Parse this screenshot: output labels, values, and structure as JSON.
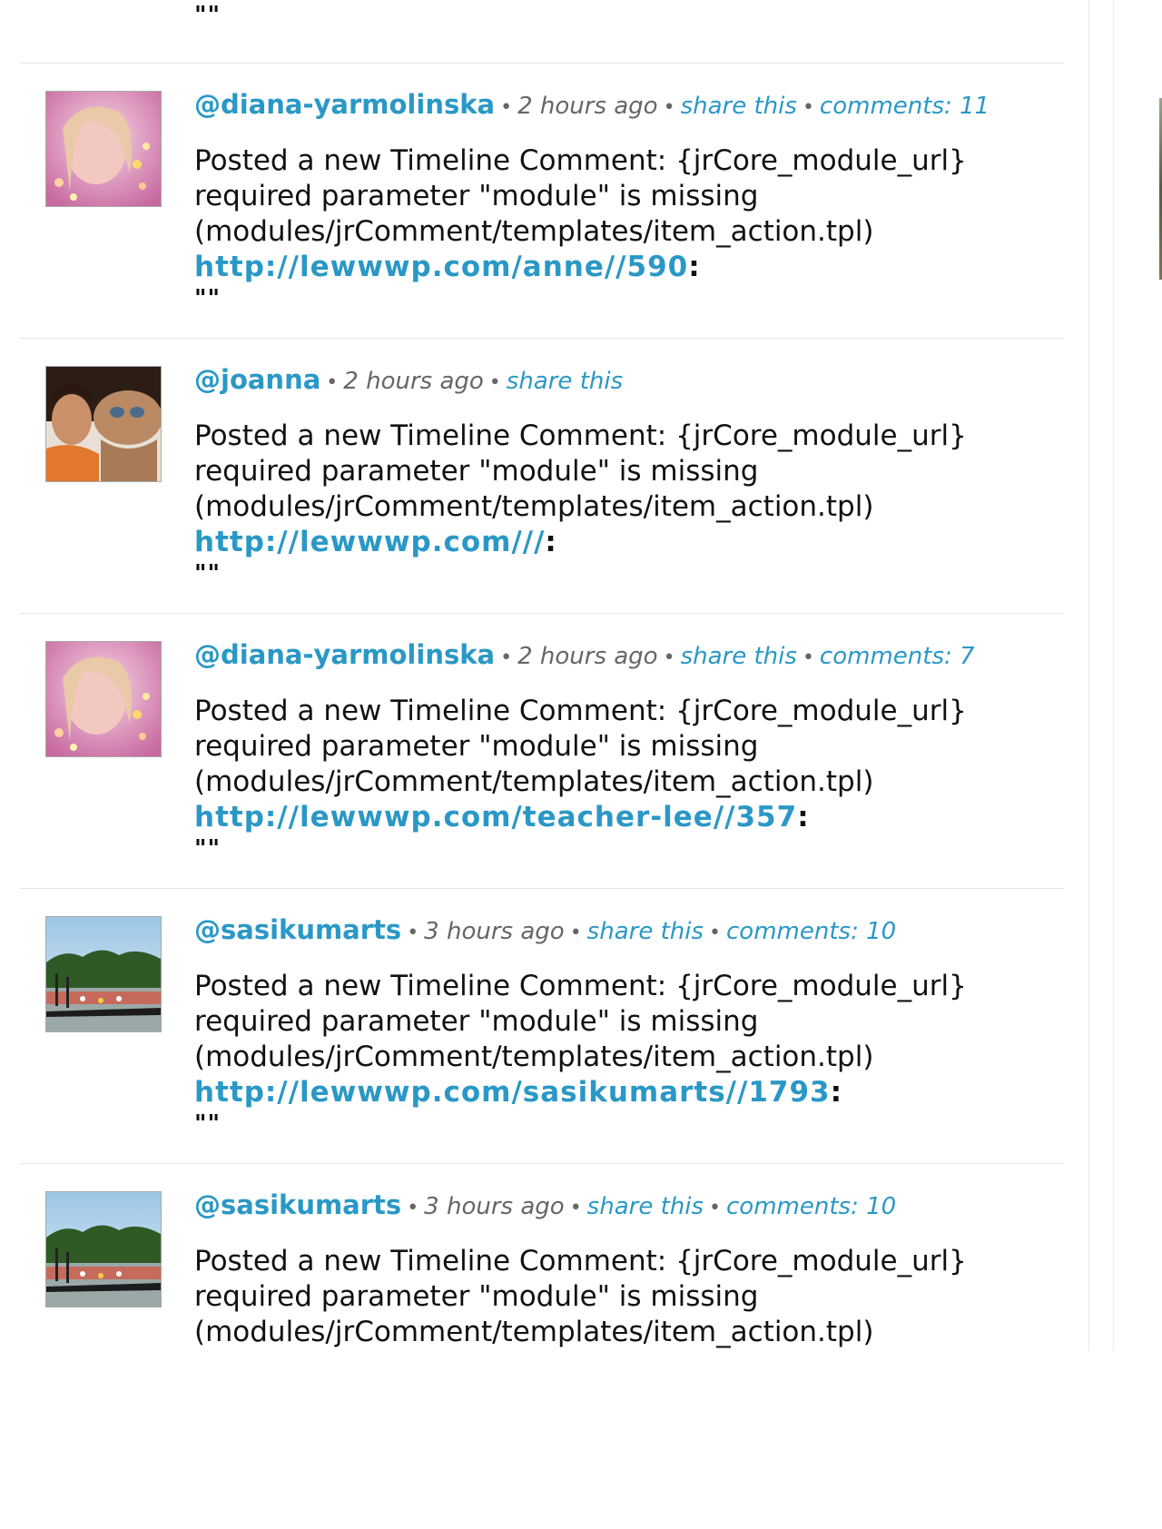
{
  "feed": {
    "top_stub": {
      "quotes": "\"\""
    },
    "separator": "•",
    "entries": [
      {
        "user": "@diana-yarmolinska",
        "time": "2 hours ago",
        "share": "share this",
        "comments": "comments: 11",
        "line1": "Posted a new Timeline Comment: {jrCore_module_url}",
        "line2": "required parameter \"module\" is missing",
        "line3": "(modules/jrComment/templates/item_action.tpl)",
        "url": "http://lewwwp.com/anne//590",
        "colon": ":",
        "quotes": "\"\"",
        "avatar": "diana-avatar"
      },
      {
        "user": "@joanna",
        "time": "2 hours ago",
        "share": "share this",
        "comments": "",
        "line1": "Posted a new Timeline Comment: {jrCore_module_url}",
        "line2": "required parameter \"module\" is missing",
        "line3": "(modules/jrComment/templates/item_action.tpl)",
        "url": "http://lewwwp.com///",
        "colon": ":",
        "quotes": "\"\"",
        "avatar": "joanna-avatar"
      },
      {
        "user": "@diana-yarmolinska",
        "time": "2 hours ago",
        "share": "share this",
        "comments": "comments: 7",
        "line1": "Posted a new Timeline Comment: {jrCore_module_url}",
        "line2": "required parameter \"module\" is missing",
        "line3": "(modules/jrComment/templates/item_action.tpl)",
        "url": "http://lewwwp.com/teacher-lee//357",
        "colon": ":",
        "quotes": "\"\"",
        "avatar": "diana-avatar"
      },
      {
        "user": "@sasikumarts",
        "time": "3 hours ago",
        "share": "share this",
        "comments": "comments: 10",
        "line1": "Posted a new Timeline Comment: {jrCore_module_url}",
        "line2": "required parameter \"module\" is missing",
        "line3": "(modules/jrComment/templates/item_action.tpl)",
        "url": "http://lewwwp.com/sasikumarts//1793",
        "colon": ":",
        "quotes": "\"\"",
        "avatar": "boat-race-avatar"
      },
      {
        "user": "@sasikumarts",
        "time": "3 hours ago",
        "share": "share this",
        "comments": "comments: 10",
        "line1": "Posted a new Timeline Comment: {jrCore_module_url}",
        "line2": "required parameter \"module\" is missing",
        "line3": "(modules/jrComment/templates/item_action.tpl)",
        "url": "",
        "colon": "",
        "quotes": "",
        "avatar": "boat-race-avatar"
      }
    ]
  },
  "colors": {
    "link": "#2a98c6",
    "meta": "#666666",
    "text": "#111111",
    "divider": "#e6e6e6"
  }
}
